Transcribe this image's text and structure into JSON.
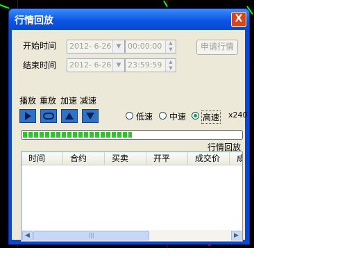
{
  "window": {
    "title": "行情回放",
    "close_label": "X"
  },
  "start": {
    "label": "开始时间",
    "date": "2012- 6-26",
    "time": "00:00:00"
  },
  "end": {
    "label": "结束时间",
    "date": "2012- 6-26",
    "time": "23:59:59"
  },
  "apply_button": "申请行情",
  "controls": {
    "labels": [
      "播放",
      "重放",
      "加速",
      "减速"
    ]
  },
  "speed": {
    "options": [
      {
        "label": "低速",
        "checked": false
      },
      {
        "label": "中速",
        "checked": false
      },
      {
        "label": "高速",
        "checked": true
      }
    ],
    "multiplier": "x240"
  },
  "progress": {
    "fraction": 0.5
  },
  "list": {
    "title": "行情回放",
    "columns": [
      "时间",
      "合约",
      "买卖",
      "开平",
      "成交价",
      "成"
    ]
  },
  "colors": {
    "title_bar": "#0a46d8",
    "close": "#d8431e",
    "dialog": "#ece9d8",
    "progress": "#28c828"
  }
}
